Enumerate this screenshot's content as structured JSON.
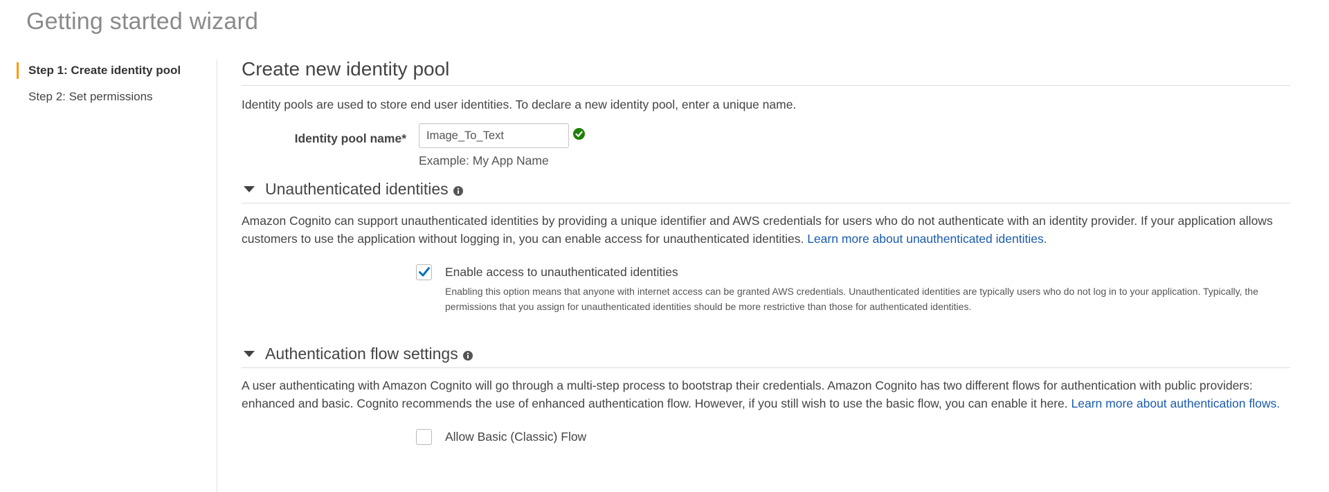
{
  "page": {
    "title": "Getting started wizard"
  },
  "sidebar": {
    "steps": [
      {
        "label": "Step 1: Create identity pool"
      },
      {
        "label": "Step 2: Set permissions"
      }
    ]
  },
  "main": {
    "heading": "Create new identity pool",
    "intro": "Identity pools are used to store end user identities. To declare a new identity pool, enter a unique name.",
    "pool_name": {
      "label": "Identity pool name*",
      "value": "Image_To_Text",
      "help": "Example: My App Name"
    },
    "unauth": {
      "title": "Unauthenticated identities",
      "description": "Amazon Cognito can support unauthenticated identities by providing a unique identifier and AWS credentials for users who do not authenticate with an identity provider. If your application allows customers to use the application without logging in, you can enable access for unauthenticated identities.",
      "link": "Learn more about unauthenticated identities.",
      "checkbox_label": "Enable access to unauthenticated identities",
      "checkbox_checked": true,
      "checkbox_help": "Enabling this option means that anyone with internet access can be granted AWS credentials. Unauthenticated identities are typically users who do not log in to your application. Typically, the permissions that you assign for unauthenticated identities should be more restrictive than those for authenticated identities."
    },
    "auth_flow": {
      "title": "Authentication flow settings",
      "description": "A user authenticating with Amazon Cognito will go through a multi-step process to bootstrap their credentials. Amazon Cognito has two different flows for authentication with public providers: enhanced and basic. Cognito recommends the use of enhanced authentication flow. However, if you still wish to use the basic flow, you can enable it here.",
      "link": "Learn more about authentication flows.",
      "checkbox_label": "Allow Basic (Classic) Flow",
      "checkbox_checked": false
    }
  },
  "colors": {
    "accent": "#ff9900",
    "link": "#1a5bab",
    "success": "#1d8102",
    "checkmark": "#0073bb"
  }
}
